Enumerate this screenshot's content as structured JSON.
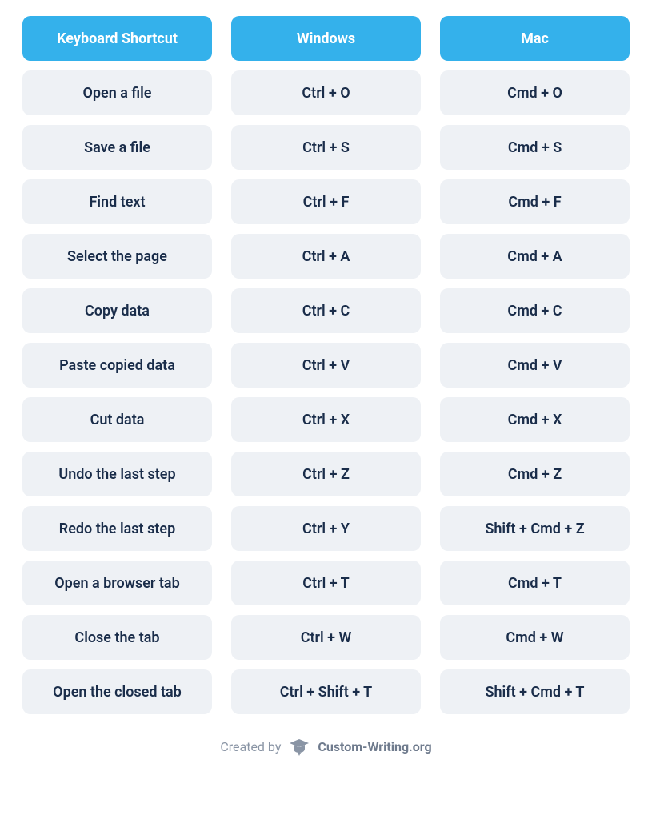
{
  "table": {
    "headers": [
      "Keyboard Shortcut",
      "Windows",
      "Mac"
    ],
    "rows": [
      {
        "shortcut": "Open a file",
        "windows": "Ctrl + O",
        "mac": "Cmd + O"
      },
      {
        "shortcut": "Save a file",
        "windows": "Ctrl + S",
        "mac": "Cmd + S"
      },
      {
        "shortcut": "Find text",
        "windows": "Ctrl + F",
        "mac": "Cmd + F"
      },
      {
        "shortcut": "Select the page",
        "windows": "Ctrl + A",
        "mac": "Cmd + A"
      },
      {
        "shortcut": "Copy data",
        "windows": "Ctrl + C",
        "mac": "Cmd + C"
      },
      {
        "shortcut": "Paste copied data",
        "windows": "Ctrl + V",
        "mac": "Cmd + V"
      },
      {
        "shortcut": "Cut data",
        "windows": "Ctrl + X",
        "mac": "Cmd + X"
      },
      {
        "shortcut": "Undo the last step",
        "windows": "Ctrl + Z",
        "mac": "Cmd + Z"
      },
      {
        "shortcut": "Redo the last step",
        "windows": "Ctrl + Y",
        "mac": "Shift + Cmd + Z"
      },
      {
        "shortcut": "Open a browser tab",
        "windows": "Ctrl + T",
        "mac": "Cmd + T"
      },
      {
        "shortcut": "Close the tab",
        "windows": "Ctrl + W",
        "mac": "Cmd + W"
      },
      {
        "shortcut": "Open the closed tab",
        "windows": "Ctrl + Shift + T",
        "mac": "Shift + Cmd + T"
      }
    ]
  },
  "footer": {
    "created_by": "Created by",
    "brand": "Custom-Writing.org"
  },
  "colors": {
    "header_bg": "#34b1eb",
    "cell_bg": "#eef1f5",
    "text": "#1a2d4a"
  }
}
